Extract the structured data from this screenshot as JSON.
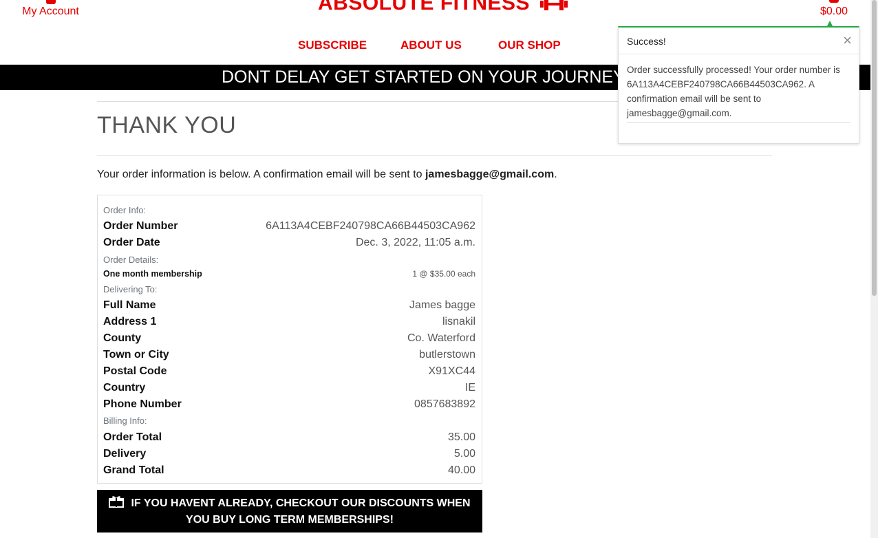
{
  "header": {
    "account_label": "My Account",
    "brand": "ABSOLUTE FITNESS",
    "bag_total": "$0.00",
    "nav": [
      "SUBSCRIBE",
      "ABOUT US",
      "OUR SHOP"
    ],
    "banner": "DONT DELAY GET STARTED ON YOUR JOURNEY TODAY"
  },
  "main": {
    "title": "THANK YOU",
    "intro_prefix": "Your order information is below. A confirmation email will be sent to ",
    "intro_email": "jamesbagge@gmail.com",
    "intro_suffix": ".",
    "sections": {
      "order_info": "Order Info:",
      "order_details": "Order Details:",
      "delivering_to": "Delivering To:",
      "billing_info": "Billing Info:"
    },
    "order": {
      "number_label": "Order Number",
      "number": "6A113A4CEBF240798CA66B44503CA962",
      "date_label": "Order Date",
      "date": "Dec. 3, 2022, 11:05 a.m."
    },
    "item": {
      "name": "One month membership",
      "qty_price": "1 @ $35.00 each"
    },
    "delivery": {
      "full_name_label": "Full Name",
      "full_name": "James bagge",
      "address1_label": "Address 1",
      "address1": "lisnakil",
      "county_label": "County",
      "county": "Co. Waterford",
      "town_label": "Town or City",
      "town": "butlerstown",
      "postcode_label": "Postal Code",
      "postcode": "X91XC44",
      "country_label": "Country",
      "country": "IE",
      "phone_label": "Phone Number",
      "phone": "0857683892"
    },
    "billing": {
      "order_total_label": "Order Total",
      "order_total": "35.00",
      "delivery_label": "Delivery",
      "delivery": "5.00",
      "grand_total_label": "Grand Total",
      "grand_total": "40.00"
    },
    "promo": "IF YOU HAVENT ALREADY, CHECKOUT OUR DISCOUNTS WHEN YOU BUY LONG TERM MEMBERSHIPS!"
  },
  "toast": {
    "title": "Success!",
    "close": "×",
    "message": "Order successfully processed! Your order number is 6A113A4CEBF240798CA66B44503CA962. A confirmation email will be sent to jamesbagge@gmail.com."
  },
  "colors": {
    "brand_red": "#e60000",
    "success_green": "#28a745",
    "banner_black": "#000000"
  }
}
